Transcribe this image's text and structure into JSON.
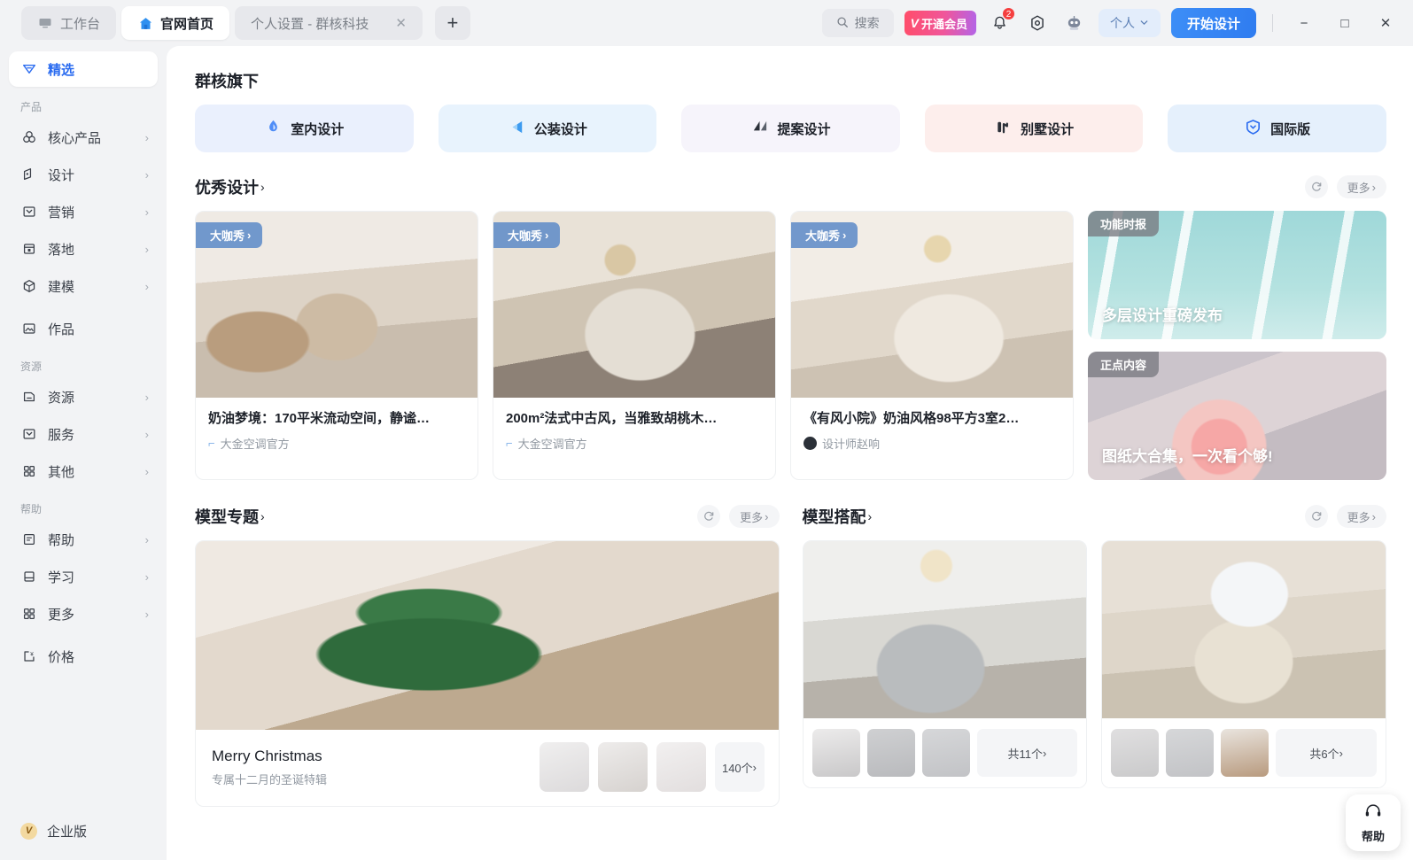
{
  "titlebar": {
    "tabs": [
      {
        "label": "工作台",
        "icon": "workbench-icon",
        "state": "inactive"
      },
      {
        "label": "官网首页",
        "icon": "home-icon",
        "state": "active"
      },
      {
        "label": "个人设置 - 群核科技",
        "icon": "",
        "state": "inactive",
        "closable": true
      }
    ],
    "new_tab_label": "+",
    "close_glyph": "✕",
    "search_placeholder": "搜索",
    "vip_label": "开通会员",
    "vip_mark": "V",
    "notification_badge": "2",
    "person_label": "个人",
    "start_design_label": "开始设计",
    "window_minimize": "−",
    "window_maximize": "□",
    "window_close": "✕"
  },
  "sidebar": {
    "featured": {
      "label": "精选",
      "icon": "tag-icon"
    },
    "groups": [
      {
        "title": "产品",
        "items": [
          {
            "label": "核心产品",
            "icon": "venn-icon",
            "arrow": "›"
          },
          {
            "label": "设计",
            "icon": "pen-icon",
            "arrow": "›"
          },
          {
            "label": "营销",
            "icon": "megaphone-icon",
            "arrow": "›"
          },
          {
            "label": "落地",
            "icon": "calendar-icon",
            "arrow": "›"
          },
          {
            "label": "建模",
            "icon": "cube-icon",
            "arrow": "›"
          },
          {
            "label": "作品",
            "icon": "image-icon",
            "arrow": ""
          }
        ]
      },
      {
        "title": "资源",
        "items": [
          {
            "label": "资源",
            "icon": "folder-icon",
            "arrow": "›"
          },
          {
            "label": "服务",
            "icon": "service-icon",
            "arrow": "›"
          },
          {
            "label": "其他",
            "icon": "grid-icon",
            "arrow": "›"
          }
        ]
      },
      {
        "title": "帮助",
        "items": [
          {
            "label": "帮助",
            "icon": "doc-icon",
            "arrow": "›"
          },
          {
            "label": "学习",
            "icon": "book-icon",
            "arrow": "›"
          },
          {
            "label": "更多",
            "icon": "grid-icon",
            "arrow": "›"
          },
          {
            "label": "价格",
            "icon": "price-icon",
            "arrow": ""
          }
        ]
      }
    ],
    "enterprise": {
      "label": "企业版",
      "badge": "V"
    }
  },
  "main": {
    "brands": {
      "title": "群核旗下",
      "tiles": [
        {
          "label": "室内设计",
          "icon": "interior-design-icon",
          "bg": "#eaf0fd",
          "icon_color": "#3d7df5"
        },
        {
          "label": "公装设计",
          "icon": "commercial-design-icon",
          "bg": "#e8f3fd",
          "icon_color": "#2e8ae6"
        },
        {
          "label": "提案设计",
          "icon": "proposal-design-icon",
          "bg": "#f6f4fb",
          "icon_color": "#2b3038"
        },
        {
          "label": "别墅设计",
          "icon": "villa-design-icon",
          "bg": "#fdeeec",
          "icon_color": "#2b3038"
        },
        {
          "label": "国际版",
          "icon": "international-icon",
          "bg": "#e5f0fc",
          "icon_color": "#2b6cf0"
        }
      ]
    },
    "excellent": {
      "title": "优秀设计",
      "chevron": "›",
      "refresh_icon": "refresh-icon",
      "more_label": "更多",
      "more_chevron": "›",
      "cards": [
        {
          "badge": "大咖秀",
          "badge_chevron": "›",
          "title": "奶油梦境：170平米流动空间，静谧…",
          "author": "大金空调官方",
          "avatar_type": "dash",
          "image": "living-room-cream"
        },
        {
          "badge": "大咖秀",
          "badge_chevron": "›",
          "title": "200m²法式中古风，当雅致胡桃木…",
          "author": "大金空调官方",
          "avatar_type": "dash",
          "image": "living-room-french"
        },
        {
          "badge": "大咖秀",
          "badge_chevron": "›",
          "title": "《有风小院》奶油风格98平方3室2…",
          "author": "设计师赵响",
          "avatar_type": "photo",
          "image": "living-room-windcourt"
        }
      ],
      "promos": [
        {
          "tag": "功能时报",
          "caption": "多层设计重磅发布",
          "image": "neon-tunnel"
        },
        {
          "tag": "正点内容",
          "caption": "图纸大合集，一次看个够!",
          "image": "pink-room"
        }
      ]
    },
    "model_topic": {
      "title": "模型专题",
      "chevron": "›",
      "refresh_icon": "refresh-icon",
      "more_label": "更多",
      "more_chevron": "›",
      "card": {
        "name": "Merry Christmas",
        "subtitle": "专属十二月的圣诞特辑",
        "image": "christmas-tree-room",
        "thumbs": [
          "candles",
          "santa",
          "stars"
        ],
        "count_label": "140个",
        "count_chevron": "›"
      }
    },
    "model_match": {
      "title": "模型搭配",
      "chevron": "›",
      "refresh_icon": "refresh-icon",
      "more_label": "更多",
      "more_chevron": "›",
      "cards": [
        {
          "image": "bedroom-modern",
          "thumbs": [
            "curtains",
            "wall-art",
            "shelf"
          ],
          "count_label": "共11个",
          "count_chevron": "›"
        },
        {
          "image": "living-room-window",
          "thumbs": [
            "radiator",
            "table-lamps",
            "wardrobe"
          ],
          "count_label": "共6个",
          "count_chevron": "›"
        }
      ]
    }
  },
  "help_fab": {
    "label": "帮助",
    "icon": "headset-icon"
  }
}
